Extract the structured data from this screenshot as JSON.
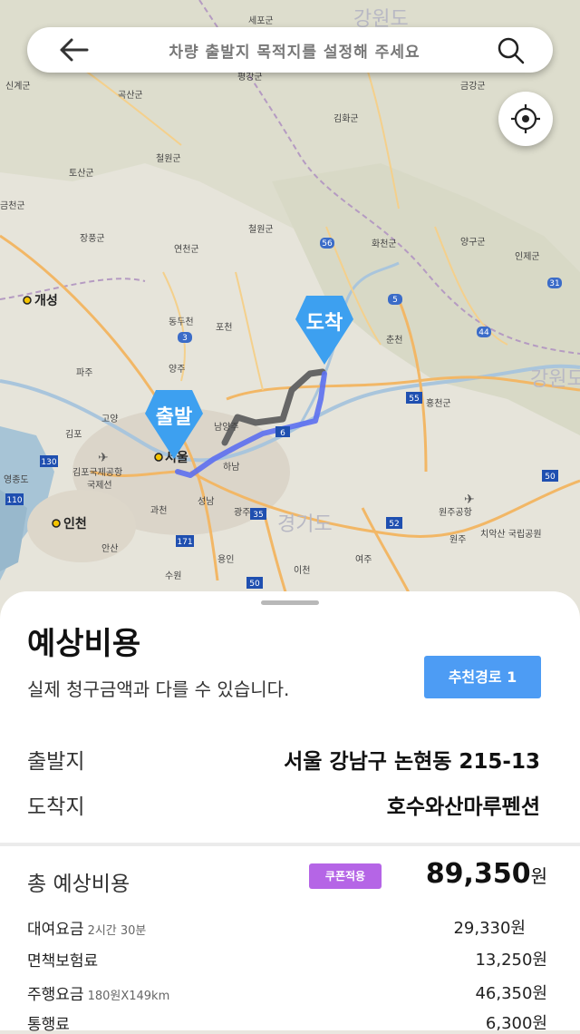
{
  "search": {
    "placeholder": "차량 출발지 목적지를 설정해 주세요"
  },
  "map": {
    "regions": [
      "강원도",
      "경기도",
      "강원도"
    ],
    "cities": [
      "세포군",
      "신계군",
      "평강군",
      "금강군",
      "김화군",
      "곡산군",
      "철원군",
      "토산군",
      "금천군",
      "철원군",
      "화천군",
      "양구군",
      "인제군",
      "장풍군",
      "연천군",
      "개성",
      "동두천",
      "포천",
      "춘천",
      "파주",
      "양주",
      "고양",
      "남양주",
      "홍천군",
      "김포",
      "서울",
      "하남",
      "김포국제공항",
      "국제선",
      "영종도",
      "성남",
      "광주",
      "인천",
      "과천",
      "안산",
      "수원",
      "용인",
      "이천",
      "여주",
      "원주",
      "치악산 국립공원",
      "원주공항"
    ],
    "route_shields": [
      "56",
      "5",
      "31",
      "44",
      "3",
      "55",
      "130",
      "110",
      "6",
      "35",
      "52",
      "50",
      "171",
      "50"
    ],
    "start_pin": "출발",
    "end_pin": "도착"
  },
  "sheet": {
    "title": "예상비용",
    "subtitle": "실제 청구금액과 다를 수 있습니다.",
    "route_button": "추천경로 1",
    "origin_label": "출발지",
    "origin_value": "서울 강남구 논현동 215-13",
    "dest_label": "도착지",
    "dest_value": "호수와산마루펜션",
    "total_label": "총 예상비용",
    "coupon_badge": "쿠폰적용",
    "total_amount": "89,350",
    "currency": "원",
    "fees": [
      {
        "label": "대여요금",
        "sub": "2시간 30분",
        "value": "29,330원"
      },
      {
        "label": "면책보험료",
        "sub": "",
        "value": "13,250원"
      },
      {
        "label": "주행요금",
        "sub": "180원X149km",
        "value": "46,350원"
      },
      {
        "label": "통행료",
        "sub": "",
        "value": "6,300원"
      }
    ]
  },
  "colors": {
    "accent_blue": "#4d9cf4",
    "pin_blue": "#3da0f0",
    "coupon_purple": "#b565e6",
    "route_blue": "#5c6ff0",
    "route_gray": "#666666"
  }
}
